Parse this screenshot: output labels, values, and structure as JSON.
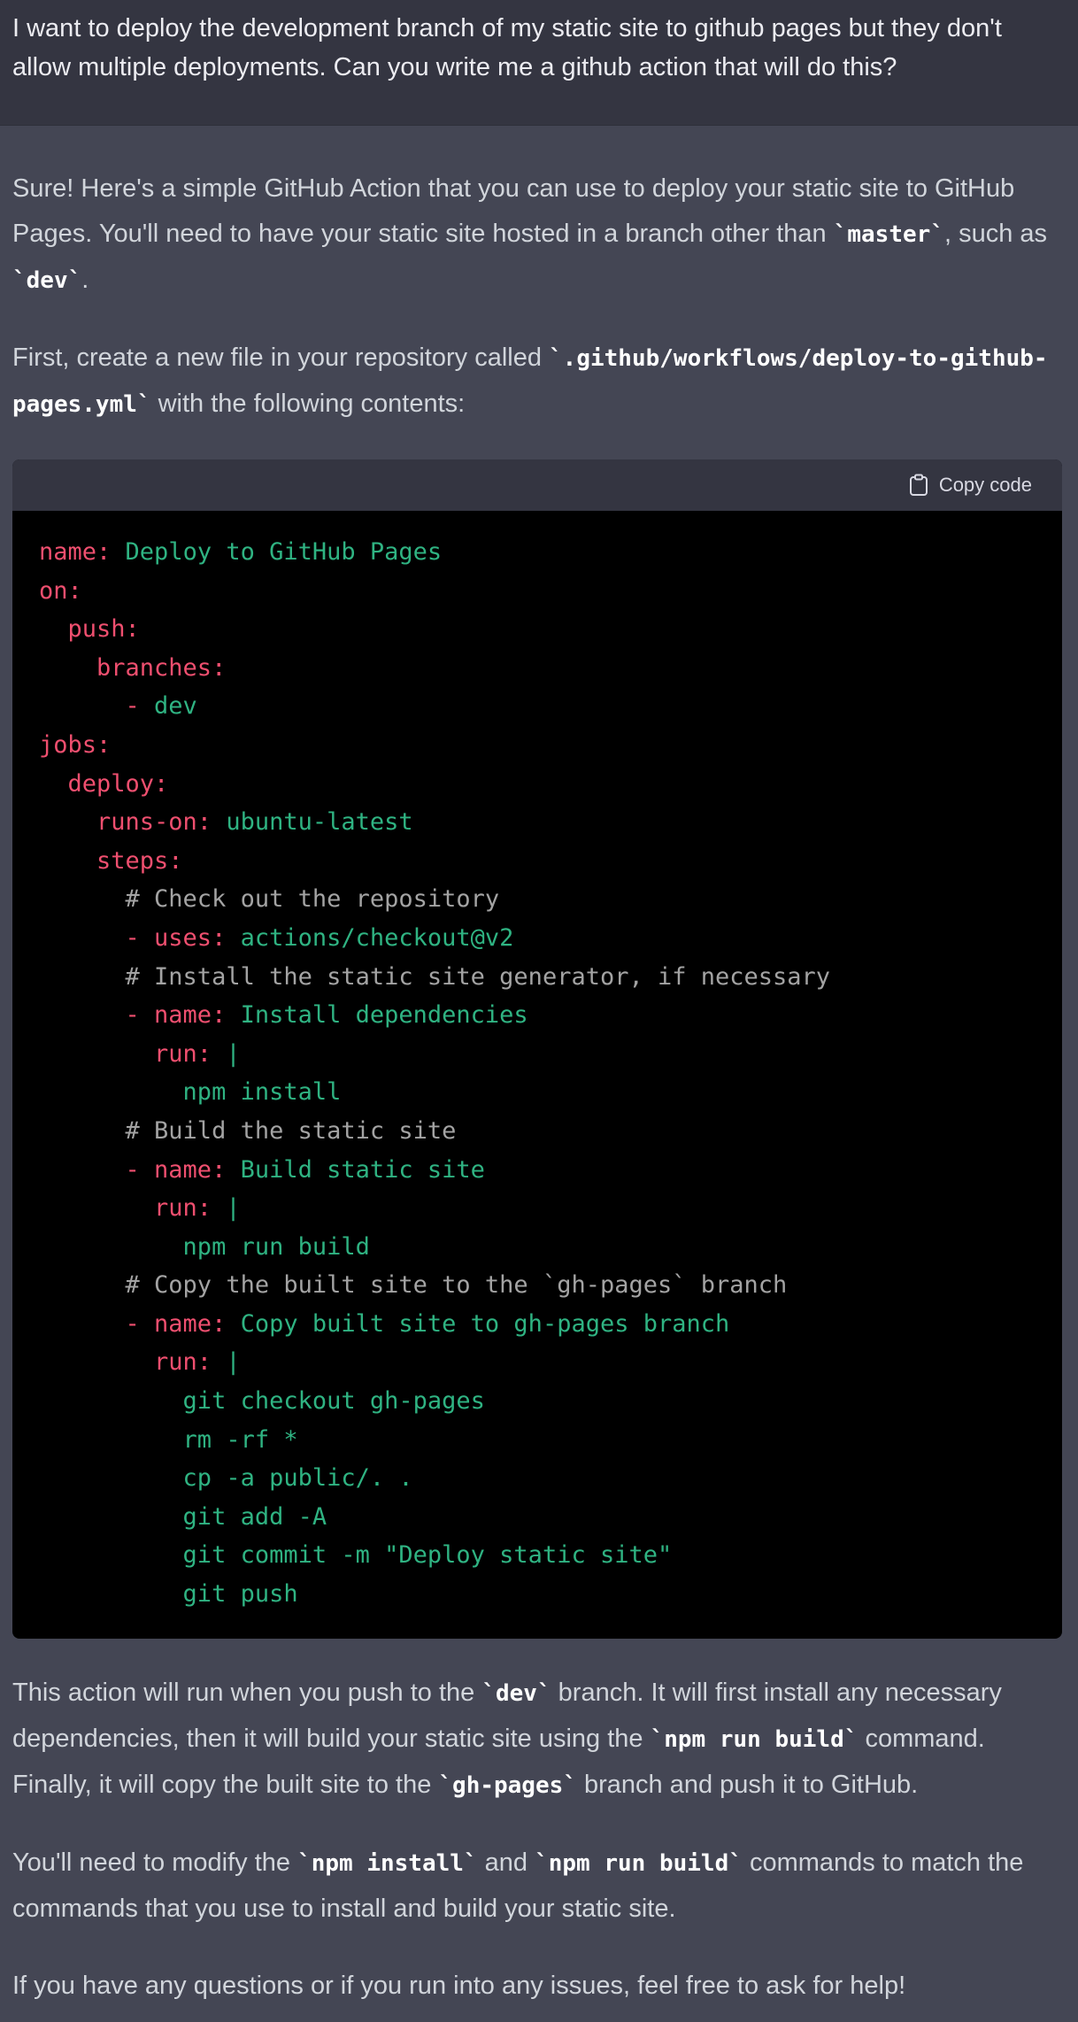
{
  "user": {
    "message": "I want to deploy the development branch of my static site to github pages but they don't allow multiple deployments. Can you write me a github action that will do this?"
  },
  "assistant": {
    "p1": {
      "t1": "Sure! Here's a simple GitHub Action that you can use to deploy your static site to GitHub Pages. You'll need to have your static site hosted in a branch other than ",
      "c1": "`master`",
      "t2": ", such as ",
      "c2": "`dev`",
      "t3": "."
    },
    "p2": {
      "t1": "First, create a new file in your repository called ",
      "c1": "`.github/workflows/deploy-to-github-pages.yml`",
      "t2": " with the following contents:"
    },
    "code_block": {
      "copy_label": "Copy code",
      "lines": [
        [
          {
            "k": "name: "
          },
          {
            "v": "Deploy to GitHub Pages"
          }
        ],
        [
          {
            "k": "on:"
          }
        ],
        [
          {
            "k": "  push:"
          }
        ],
        [
          {
            "k": "    branches:"
          }
        ],
        [
          {
            "k": "      - "
          },
          {
            "v": "dev"
          }
        ],
        [
          {
            "k": "jobs:"
          }
        ],
        [
          {
            "k": "  deploy:"
          }
        ],
        [
          {
            "k": "    runs-on: "
          },
          {
            "v": "ubuntu-latest"
          }
        ],
        [
          {
            "k": "    steps:"
          }
        ],
        [
          {
            "c": "      # Check out the repository"
          }
        ],
        [
          {
            "k": "      - uses: "
          },
          {
            "v": "actions/checkout@v2"
          }
        ],
        [
          {
            "c": "      # Install the static site generator, if necessary"
          }
        ],
        [
          {
            "k": "      - name: "
          },
          {
            "v": "Install dependencies"
          }
        ],
        [
          {
            "k": "        run: "
          },
          {
            "v": "|"
          }
        ],
        [
          {
            "v": "          npm install"
          }
        ],
        [
          {
            "c": "      # Build the static site"
          }
        ],
        [
          {
            "k": "      - name: "
          },
          {
            "v": "Build static site"
          }
        ],
        [
          {
            "k": "        run: "
          },
          {
            "v": "|"
          }
        ],
        [
          {
            "v": "          npm run build"
          }
        ],
        [
          {
            "c": "      # Copy the built site to the `gh-pages` branch"
          }
        ],
        [
          {
            "k": "      - name: "
          },
          {
            "v": "Copy built site to gh-pages branch"
          }
        ],
        [
          {
            "k": "        run: "
          },
          {
            "v": "|"
          }
        ],
        [
          {
            "v": "          git checkout gh-pages"
          }
        ],
        [
          {
            "v": "          rm -rf *"
          }
        ],
        [
          {
            "v": "          cp -a public/. ."
          }
        ],
        [
          {
            "v": "          git add -A"
          }
        ],
        [
          {
            "v": "          git commit -m \"Deploy static site\""
          }
        ],
        [
          {
            "v": "          git push"
          }
        ]
      ]
    },
    "p3": {
      "t1": "This action will run when you push to the ",
      "c1": "`dev`",
      "t2": " branch. It will first install any necessary dependencies, then it will build your static site using the ",
      "c2": "`npm run build`",
      "t3": " command. Finally, it will copy the built site to the ",
      "c3": "`gh-pages`",
      "t4": " branch and push it to GitHub."
    },
    "p4": {
      "t1": "You'll need to modify the ",
      "c1": "`npm install`",
      "t2": " and ",
      "c2": "`npm run build`",
      "t3": " commands to match the commands that you use to install and build your static site."
    },
    "p5": {
      "t1": "If you have any questions or if you run into any issues, feel free to ask for help!"
    }
  }
}
